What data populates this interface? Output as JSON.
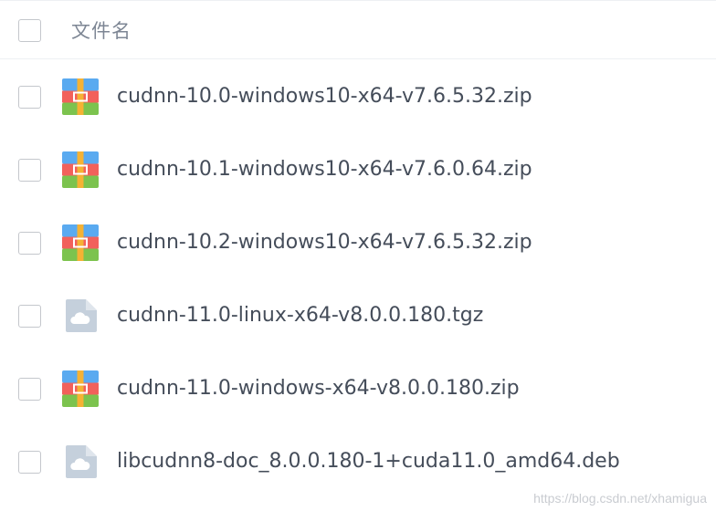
{
  "header": {
    "column_label": "文件名"
  },
  "files": [
    {
      "name": "cudnn-10.0-windows10-x64-v7.6.5.32.zip",
      "icon": "archive-zip-icon"
    },
    {
      "name": "cudnn-10.1-windows10-x64-v7.6.0.64.zip",
      "icon": "archive-zip-icon"
    },
    {
      "name": "cudnn-10.2-windows10-x64-v7.6.5.32.zip",
      "icon": "archive-zip-icon"
    },
    {
      "name": "cudnn-11.0-linux-x64-v8.0.0.180.tgz",
      "icon": "cloud-file-icon"
    },
    {
      "name": "cudnn-11.0-windows-x64-v8.0.0.180.zip",
      "icon": "archive-zip-icon"
    },
    {
      "name": "libcudnn8-doc_8.0.0.180-1+cuda11.0_amd64.deb",
      "icon": "cloud-file-icon"
    }
  ],
  "watermark": "https://blog.csdn.net/xhamigua",
  "colors": {
    "zip_top": "#5aaaf0",
    "zip_middle": "#f2615b",
    "zip_bottom": "#7cc34e",
    "zip_stripe": "#f5b234",
    "cloud_file": "#c5d0dc"
  }
}
